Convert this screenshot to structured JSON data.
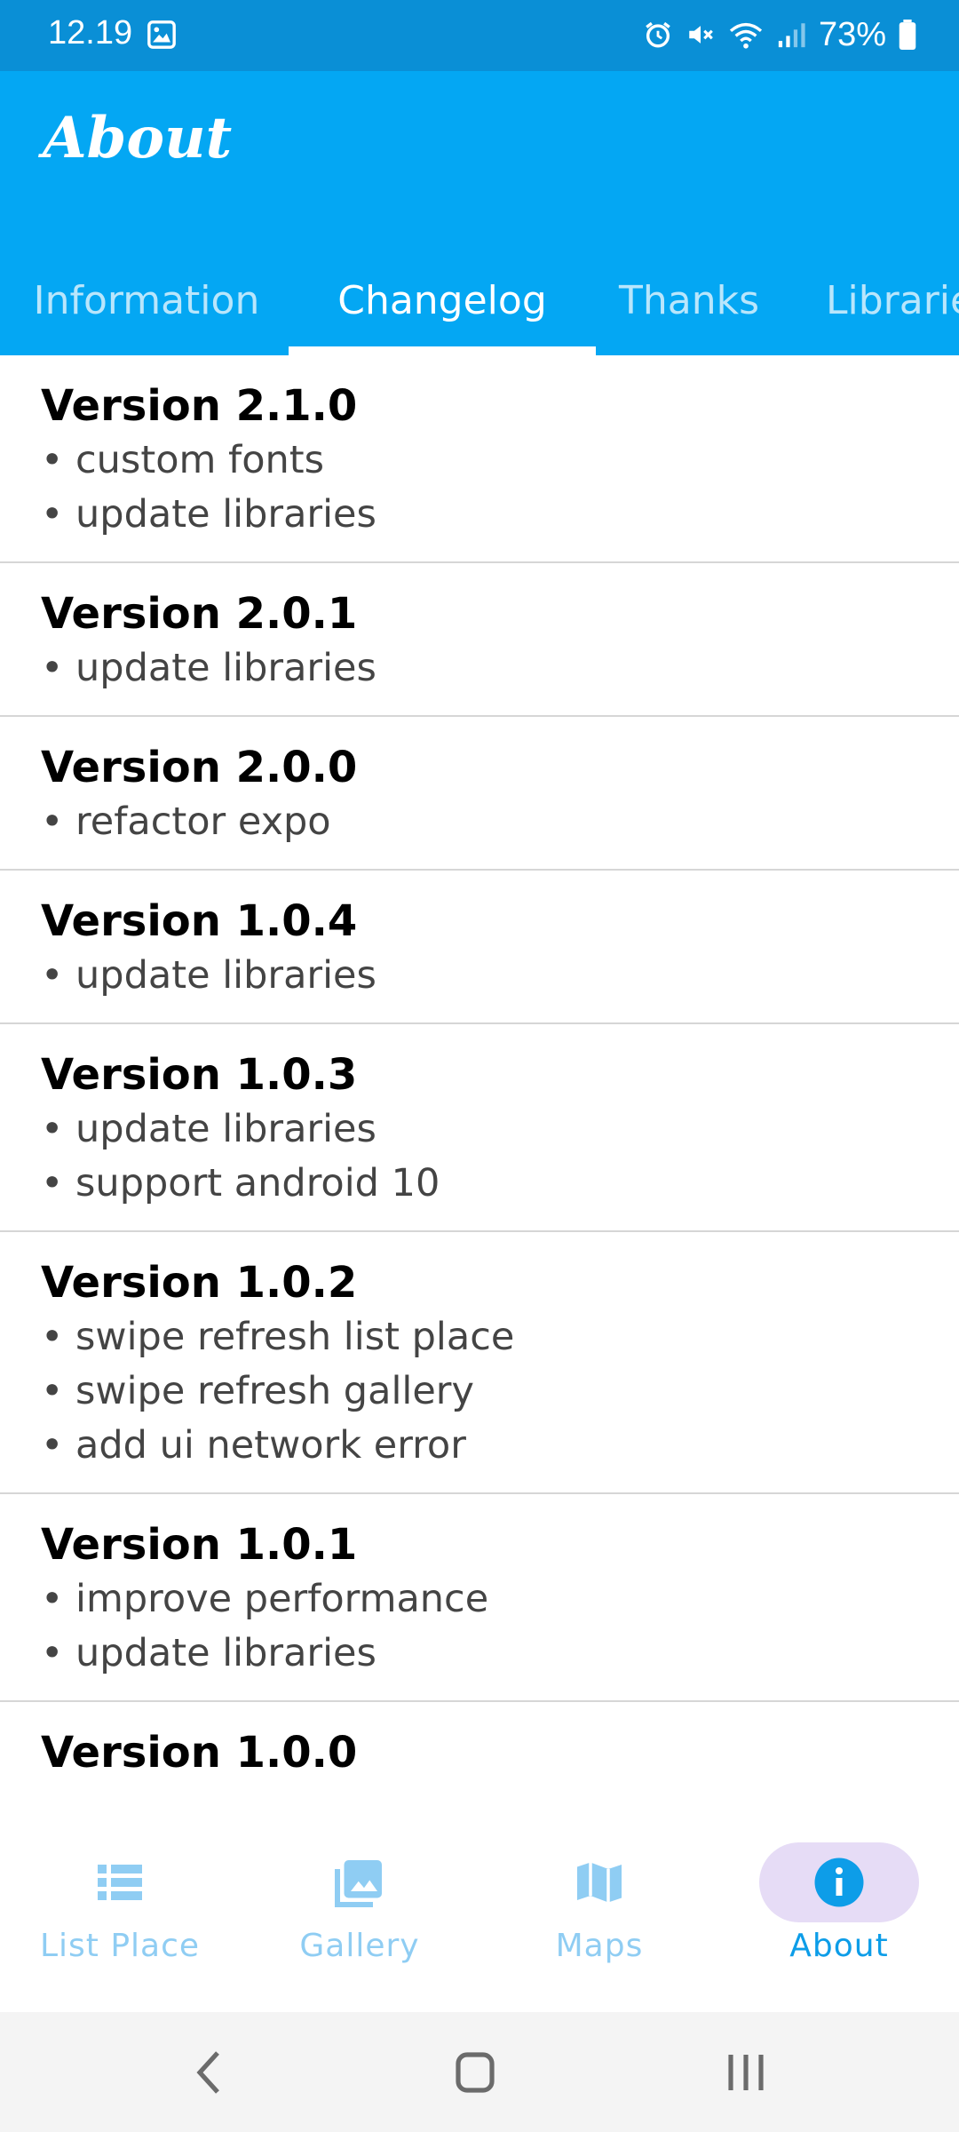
{
  "status_bar": {
    "time": "12.19",
    "battery": "73%",
    "icons": [
      "image-icon",
      "alarm-icon",
      "mute-icon",
      "wifi-icon",
      "signal-icon",
      "battery-icon"
    ]
  },
  "header": {
    "title": "About",
    "tabs": [
      {
        "label": "Information",
        "active": false
      },
      {
        "label": "Changelog",
        "active": true
      },
      {
        "label": "Thanks",
        "active": false
      },
      {
        "label": "Libraries",
        "active": false
      }
    ]
  },
  "changelog": [
    {
      "version": "Version 2.1.0",
      "items": [
        "• custom fonts",
        "• update libraries"
      ]
    },
    {
      "version": "Version 2.0.1",
      "items": [
        "• update libraries"
      ]
    },
    {
      "version": "Version 2.0.0",
      "items": [
        "• refactor expo"
      ]
    },
    {
      "version": "Version 1.0.4",
      "items": [
        "• update libraries"
      ]
    },
    {
      "version": "Version 1.0.3",
      "items": [
        "• update libraries",
        "• support android 10"
      ]
    },
    {
      "version": "Version 1.0.2",
      "items": [
        "• swipe refresh list place",
        "• swipe refresh gallery",
        "• add ui network error"
      ]
    },
    {
      "version": "Version 1.0.1",
      "items": [
        "• improve performance",
        "• update libraries"
      ]
    },
    {
      "version": "Version 1.0.0",
      "items": []
    }
  ],
  "bottom_nav": [
    {
      "label": "List Place",
      "icon": "list-icon",
      "active": false
    },
    {
      "label": "Gallery",
      "icon": "gallery-icon",
      "active": false
    },
    {
      "label": "Maps",
      "icon": "map-icon",
      "active": false
    },
    {
      "label": "About",
      "icon": "info-icon",
      "active": true
    }
  ],
  "colors": {
    "status_bar": "#0a8fd6",
    "app_bar": "#04a7f3",
    "nav_active": "#0d9de8",
    "nav_inactive": "#8fcdf3",
    "nav_pill": "#e6dcf6"
  }
}
